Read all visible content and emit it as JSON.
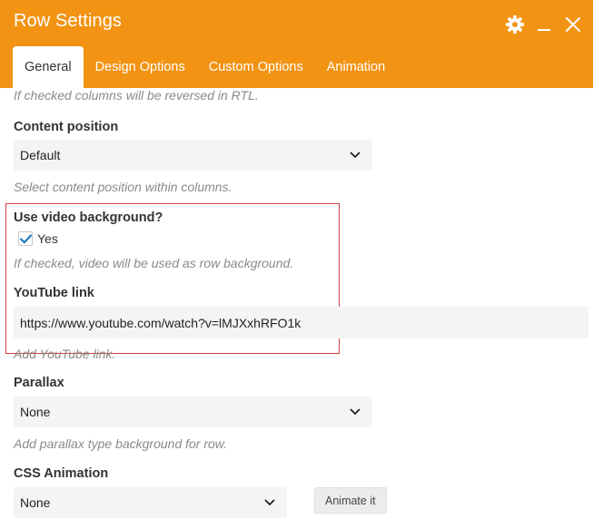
{
  "window": {
    "title": "Row Settings",
    "controls": [
      "gear-icon",
      "minimize-icon",
      "close-icon"
    ]
  },
  "tabs": [
    {
      "label": "General",
      "active": true
    },
    {
      "label": "Design Options",
      "active": false
    },
    {
      "label": "Custom Options",
      "active": false
    },
    {
      "label": "Animation",
      "active": false
    }
  ],
  "fields": {
    "rtl_help": "If checked columns will be reversed in RTL.",
    "content_position": {
      "label": "Content position",
      "value": "Default",
      "help": "Select content position within columns."
    },
    "video_bg": {
      "label": "Use video background?",
      "checkbox_label": "Yes",
      "checked": true,
      "help": "If checked, video will be used as row background."
    },
    "youtube": {
      "label": "YouTube link",
      "value": "https://www.youtube.com/watch?v=lMJXxhRFO1k",
      "help": "Add YouTube link."
    },
    "parallax": {
      "label": "Parallax",
      "value": "None",
      "help": "Add parallax type background for row."
    },
    "css_animation": {
      "label": "CSS Animation",
      "value": "None",
      "button_label": "Animate it"
    }
  },
  "colors": {
    "header": "#f29313",
    "checkmark": "#1e7bbf",
    "highlight_border": "#d24242"
  }
}
